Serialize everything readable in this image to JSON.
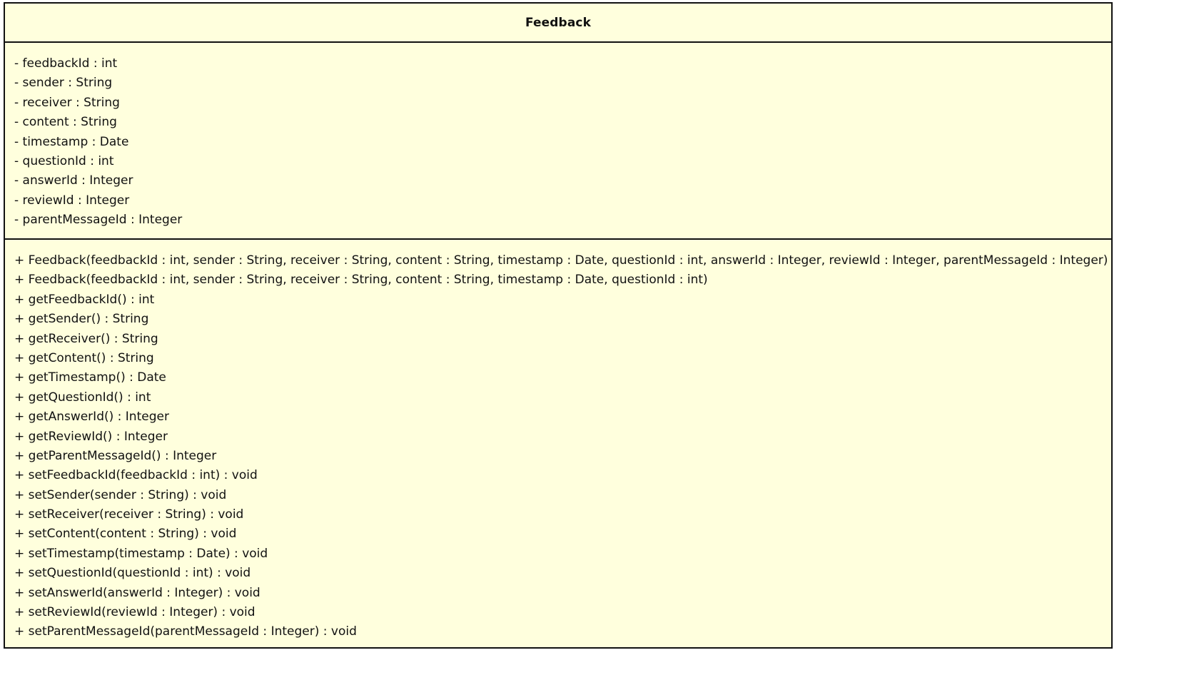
{
  "class_box": {
    "name": "Feedback",
    "fill_color": "#ffffdd",
    "border_color": "#111111",
    "attributes": [
      "- feedbackId : int",
      "- sender : String",
      "- receiver : String",
      "- content : String",
      "- timestamp : Date",
      "- questionId : int",
      "- answerId : Integer",
      "- reviewId : Integer",
      "- parentMessageId : Integer"
    ],
    "methods": [
      "+ Feedback(feedbackId : int, sender : String, receiver : String, content : String, timestamp : Date, questionId : int, answerId : Integer, reviewId : Integer, parentMessageId : Integer)",
      "+ Feedback(feedbackId : int, sender : String, receiver : String, content : String, timestamp : Date, questionId : int)",
      "+ getFeedbackId() : int",
      "+ getSender() : String",
      "+ getReceiver() : String",
      "+ getContent() : String",
      "+ getTimestamp() : Date",
      "+ getQuestionId() : int",
      "+ getAnswerId() : Integer",
      "+ getReviewId() : Integer",
      "+ getParentMessageId() : Integer",
      "+ setFeedbackId(feedbackId : int) : void",
      "+ setSender(sender : String) : void",
      "+ setReceiver(receiver : String) : void",
      "+ setContent(content : String) : void",
      "+ setTimestamp(timestamp : Date) : void",
      "+ setQuestionId(questionId : int) : void",
      "+ setAnswerId(answerId : Integer) : void",
      "+ setReviewId(reviewId : Integer) : void",
      "+ setParentMessageId(parentMessageId : Integer) : void"
    ]
  }
}
